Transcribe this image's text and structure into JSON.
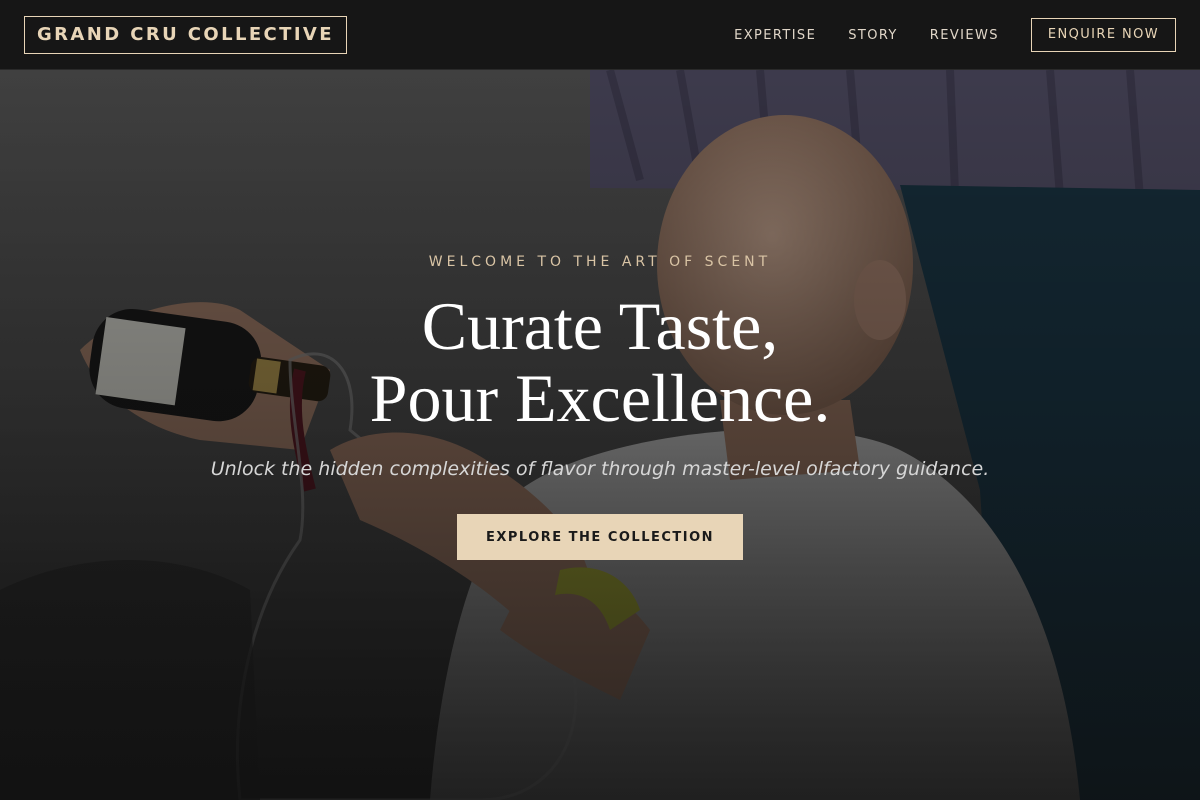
{
  "header": {
    "logo": "GRAND CRU COLLECTIVE",
    "nav": [
      {
        "label": "EXPERTISE"
      },
      {
        "label": "STORY"
      },
      {
        "label": "REVIEWS"
      }
    ],
    "cta_label": "ENQUIRE NOW"
  },
  "hero": {
    "eyebrow": "WELCOME TO THE ART OF SCENT",
    "headline_line1": "Curate Taste,",
    "headline_line2": "Pour Excellence.",
    "subline": "Unlock the hidden complexities of flavor through master-level olfactory guidance.",
    "cta_label": "EXPLORE THE COLLECTION",
    "photo_icon": "sommelier-pouring-wine-photo"
  },
  "colors": {
    "accent": "#e8d5b7",
    "header_bg": "#161616",
    "page_bg": "#141414",
    "headline": "#ffffff"
  }
}
